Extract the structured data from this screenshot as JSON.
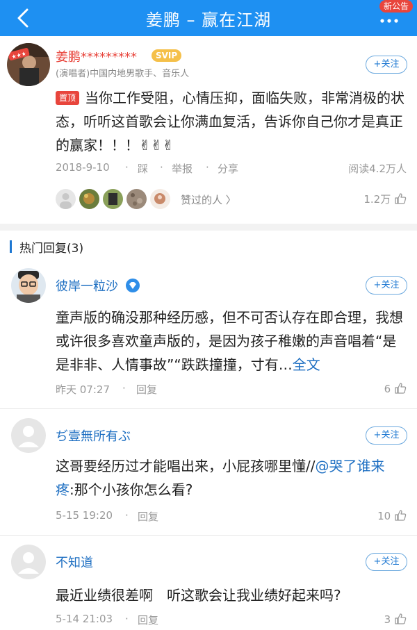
{
  "header": {
    "title": "姜鹏 – 赢在江湖",
    "notice_badge": "新公告"
  },
  "post": {
    "author_name": "姜鹏*********",
    "badge": "SVIP",
    "author_desc": "(演唱者)中国内地男歌手、音乐人",
    "follow_label": "+关注",
    "pin_tag": "置顶",
    "content": "当你工作受阻，心情压抑，面临失败，非常消极的状态，听听这首歌会让你满血复活，告诉你自己你才是真正的赢家！！！✌✌✌",
    "date": "2018-9-10",
    "step_label": "踩",
    "report_label": "举报",
    "share_label": "分享",
    "read_count": "阅读4.2万人",
    "liked_label": "赞过的人",
    "like_count": "1.2万"
  },
  "hot_replies": {
    "title": "热门回复(3)",
    "items": [
      {
        "name": "彼岸一粒沙",
        "follow_label": "+关注",
        "text": "童声版的确没那种经历感，但不可否认存在即合理，我想或许很多喜欢童声版的，是因为孩子稚嫩的声音唱着“是是非非、人情事故”“跌跌撞撞，寸有…",
        "link_text": "全文",
        "time": "昨天 07:27",
        "reply_label": "回复",
        "like_count": "6"
      },
      {
        "name": "ぢ壹無所有ぶ",
        "follow_label": "+关注",
        "text_before": "这哥要经历过才能唱出来，小屁孩哪里懂//",
        "mention": "@哭了谁来疼",
        "text_after": ":那个小孩你怎么看?",
        "time": "5-15 19:20",
        "reply_label": "回复",
        "like_count": "10"
      },
      {
        "name": "不知道",
        "follow_label": "+关注",
        "text": "最近业绩很差啊　听这歌会让我业绩好起来吗?",
        "time": "5-14 21:03",
        "reply_label": "回复",
        "like_count": "3"
      }
    ]
  },
  "colors": {
    "header_bg": "#1e90f2",
    "author_red": "#e8453c",
    "link_blue": "#1e6fc2",
    "svip_gold": "#f5c04a"
  }
}
